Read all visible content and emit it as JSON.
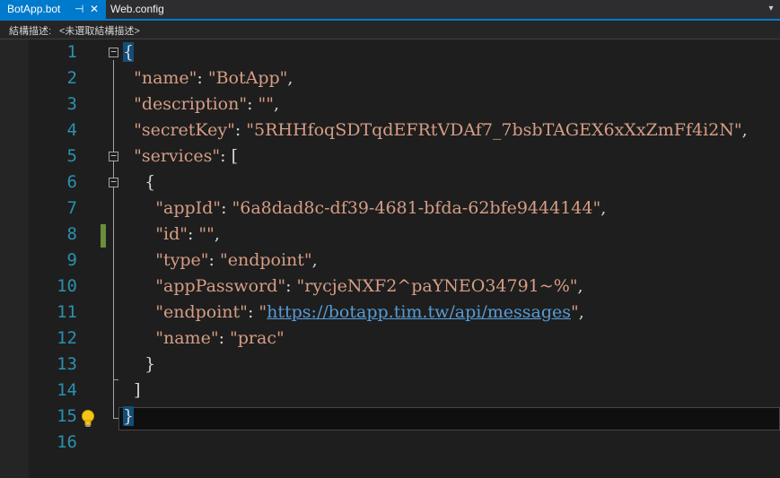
{
  "tabs": {
    "active": "BotApp.bot",
    "pin_glyph": "⊣",
    "close_glyph": "✕",
    "inactive": "Web.config",
    "dropdown_glyph": "▾"
  },
  "navbar": {
    "label": "結構描述:",
    "combo": "<未選取結構描述>"
  },
  "editor": {
    "line_numbers": [
      "1",
      "2",
      "3",
      "4",
      "5",
      "6",
      "7",
      "8",
      "9",
      "10",
      "11",
      "12",
      "13",
      "14",
      "15",
      "16"
    ],
    "code": {
      "l1_brace": "{",
      "name_key": "\"name\"",
      "name_val": "\"BotApp\"",
      "description_key": "\"description\"",
      "description_val": "\"\"",
      "secretKey_key": "\"secretKey\"",
      "secretKey_val": "\"5RHHfoqSDTqdEFRtVDAf7_7bsbTAGEX6xXxZmFf4i2N\"",
      "services_key": "\"services\"",
      "services_open": "[",
      "obj_open": "{",
      "appId_key": "\"appId\"",
      "appId_val": "\"6a8dad8c-df39-4681-bfda-62bfe9444144\"",
      "id_key": "\"id\"",
      "id_val": "\"\"",
      "type_key": "\"type\"",
      "type_val": "\"endpoint\"",
      "appPassword_key": "\"appPassword\"",
      "appPassword_val": "\"rycjeNXF2^paYNEO34791~%\"",
      "endpoint_key": "\"endpoint\"",
      "endpoint_quote": "\"",
      "endpoint_url": "https://botapp.tim.tw/api/messages",
      "name2_key": "\"name\"",
      "name2_val": "\"prac\"",
      "obj_close": "}",
      "services_close": "]",
      "l15_brace": "}"
    }
  }
}
